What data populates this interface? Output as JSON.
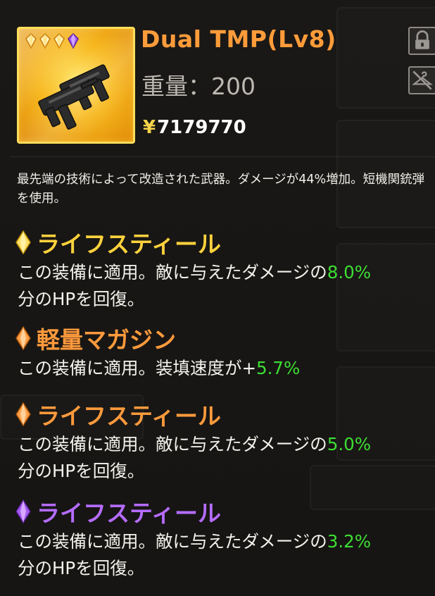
{
  "item": {
    "name": "Dual TMP(Lv8)",
    "weight_label": "重量：",
    "weight_value": "200",
    "price_symbol": "¥",
    "price": "7179770",
    "rarity_gems": [
      "gold",
      "gold",
      "gold",
      "purple"
    ]
  },
  "icons": {
    "lock": "lock-icon",
    "unequip": "hanger-slash-icon",
    "weapon": "dual-tmp-weapon-icon"
  },
  "description": "最先端の技術によって改造された武器。ダメージが44%増加。短機関銃弾を使用。",
  "perks": [
    {
      "title": "ライフスティール",
      "color": "#ffd23c",
      "gem": "yellow",
      "text_before": "この装備に適用。敵に与えたダメージの",
      "value": "8.0%",
      "text_after": "分のHPを回復。"
    },
    {
      "title": "軽量マガジン",
      "color": "#ff9a3c",
      "gem": "orange",
      "text_before": "この装備に適用。装填速度が+",
      "value": "5.7%",
      "text_after": ""
    },
    {
      "title": "ライフスティール",
      "color": "#ff9a3c",
      "gem": "orange",
      "text_before": "この装備に適用。敵に与えたダメージの",
      "value": "5.0%",
      "text_after": "分のHPを回復。"
    },
    {
      "title": "ライフスティール",
      "color": "#b56cff",
      "gem": "purple",
      "text_before": "この装備に適用。敵に与えたダメージの",
      "value": "3.2%",
      "text_after": "分のHPを回復。"
    }
  ],
  "colors": {
    "name": "#ff9c3a",
    "value_green": "#3dde33",
    "gold_frame": "#ffde5a"
  }
}
